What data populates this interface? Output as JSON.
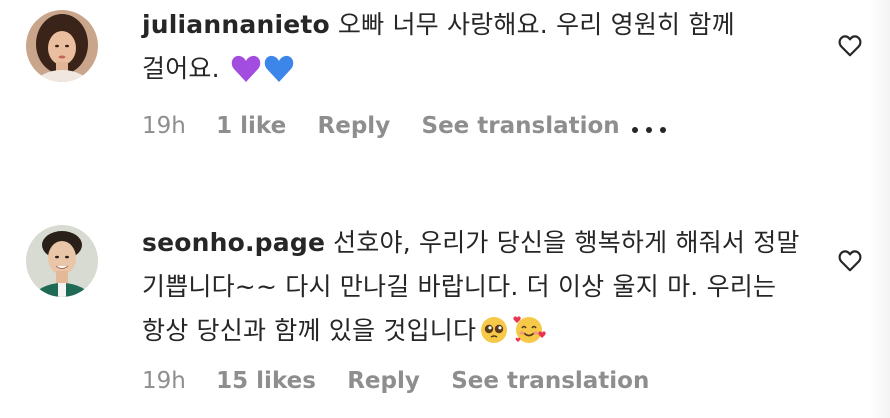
{
  "comments": [
    {
      "username": "juliannanieto",
      "text": "오빠 너무 사랑해요. 우리 영원히 함께 걸어요.",
      "emojis": [
        "purple-heart-emoji",
        "blue-heart-emoji"
      ],
      "time": "19h",
      "likes": "1 like",
      "reply": "Reply",
      "translation": "See translation",
      "more": "more-options-icon"
    },
    {
      "username": "seonho.page",
      "text": "선호야, 우리가 당신을 행복하게 해줘서 정말 기쁩니다~~ 다시 만나길 바랍니다. 더 이상 울지 마. 우리는 항상 당신과 함께 있을 것입니다",
      "emojis": [
        "pleading-face-emoji",
        "smiling-face-with-hearts-emoji"
      ],
      "time": "19h",
      "likes": "15 likes",
      "reply": "Reply",
      "translation": "See translation"
    }
  ],
  "colors": {
    "text": "#262626",
    "secondary": "#8e8e8e",
    "background": "#ffffff"
  }
}
